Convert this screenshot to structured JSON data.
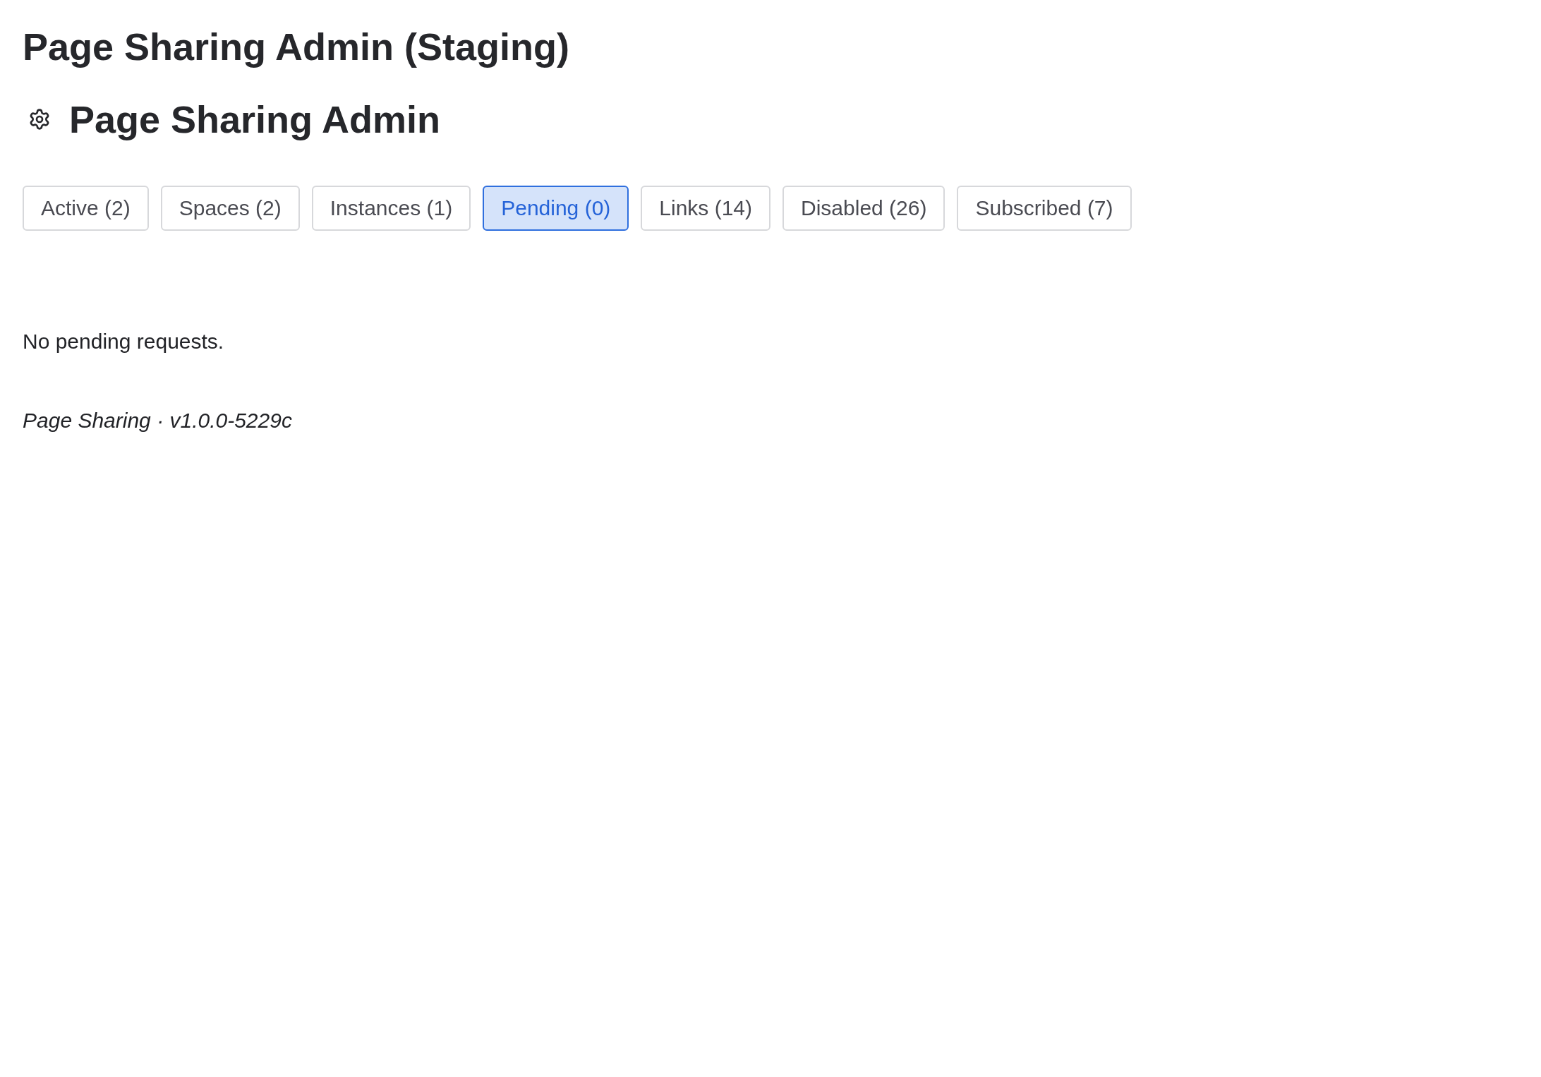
{
  "page_title": "Page Sharing Admin (Staging)",
  "header": {
    "title": "Page Sharing Admin"
  },
  "tabs": [
    {
      "label": "Active (2)",
      "selected": false
    },
    {
      "label": "Spaces (2)",
      "selected": false
    },
    {
      "label": "Instances (1)",
      "selected": false
    },
    {
      "label": "Pending (0)",
      "selected": true
    },
    {
      "label": "Links (14)",
      "selected": false
    },
    {
      "label": "Disabled (26)",
      "selected": false
    },
    {
      "label": "Subscribed (7)",
      "selected": false
    }
  ],
  "content": {
    "message": "No pending requests."
  },
  "footer": {
    "text": "Page Sharing · v1.0.0-5229c"
  }
}
